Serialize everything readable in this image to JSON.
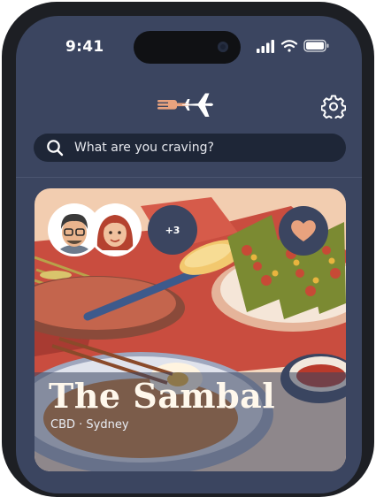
{
  "status_bar": {
    "time": "9:41"
  },
  "search": {
    "placeholder": "What are you craving?"
  },
  "card": {
    "title": "The Sambal",
    "subtitle": "CBD · Sydney",
    "extra_diners": "+3"
  },
  "colors": {
    "app_background": "#3b4560",
    "search_background": "#1e2637",
    "heart_fill": "#e8a27e",
    "logo_fork": "#e8a27e",
    "logo_plane": "#ffffff"
  },
  "icons": [
    "fork-plane-logo-icon",
    "gear-icon",
    "search-icon",
    "heart-icon",
    "signal-icon",
    "wifi-icon",
    "battery-icon",
    "avatar-man",
    "avatar-woman"
  ]
}
